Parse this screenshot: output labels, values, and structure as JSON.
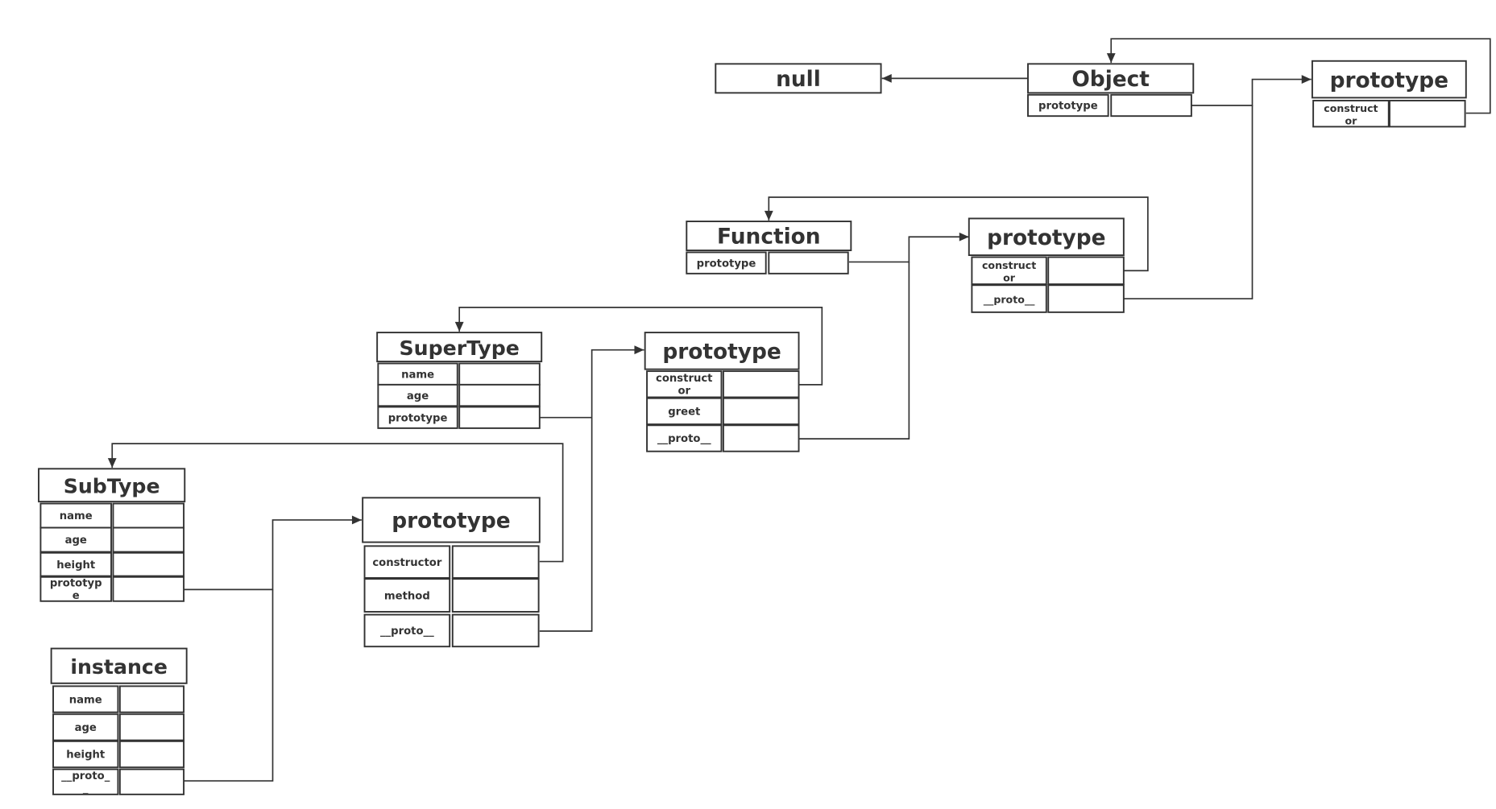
{
  "colors": {
    "stroke": "#333333",
    "background": "#ffffff"
  },
  "nodes": {
    "null": {
      "title": "null"
    },
    "object": {
      "title": "Object",
      "fields": [
        "prototype"
      ]
    },
    "object_prototype": {
      "title": "prototype",
      "fields": [
        "construct\nor"
      ]
    },
    "function": {
      "title": "Function",
      "fields": [
        "prototype"
      ]
    },
    "function_prototype": {
      "title": "prototype",
      "fields": [
        "construct\nor",
        "__proto__"
      ]
    },
    "supertype": {
      "title": "SuperType",
      "fields": [
        "name",
        "age",
        "prototype"
      ]
    },
    "supertype_prototype": {
      "title": "prototype",
      "fields": [
        "construct\nor",
        "greet",
        "__proto__"
      ]
    },
    "subtype": {
      "title": "SubType",
      "fields": [
        "name",
        "age",
        "height",
        "prototyp\ne"
      ]
    },
    "subtype_prototype": {
      "title": "prototype",
      "fields": [
        "constructor",
        "method",
        "__proto__"
      ]
    },
    "instance": {
      "title": "instance",
      "fields": [
        "name",
        "age",
        "height",
        "__proto_\n_"
      ]
    }
  },
  "edges": [
    {
      "from": "object.__proto__",
      "to": "null"
    },
    {
      "from": "object.prototype",
      "to": "object_prototype"
    },
    {
      "from": "object_prototype.constructor",
      "to": "object"
    },
    {
      "from": "function.prototype",
      "to": "function_prototype"
    },
    {
      "from": "function_prototype.constructor",
      "to": "function"
    },
    {
      "from": "function_prototype.__proto__",
      "to": "object_prototype"
    },
    {
      "from": "supertype.prototype",
      "to": "supertype_prototype"
    },
    {
      "from": "supertype_prototype.constructor",
      "to": "supertype"
    },
    {
      "from": "supertype_prototype.__proto__",
      "to": "function_prototype"
    },
    {
      "from": "subtype.prototype",
      "to": "subtype_prototype"
    },
    {
      "from": "subtype_prototype.constructor",
      "to": "subtype"
    },
    {
      "from": "subtype_prototype.__proto__",
      "to": "supertype_prototype"
    },
    {
      "from": "instance.__proto__",
      "to": "subtype_prototype"
    }
  ]
}
